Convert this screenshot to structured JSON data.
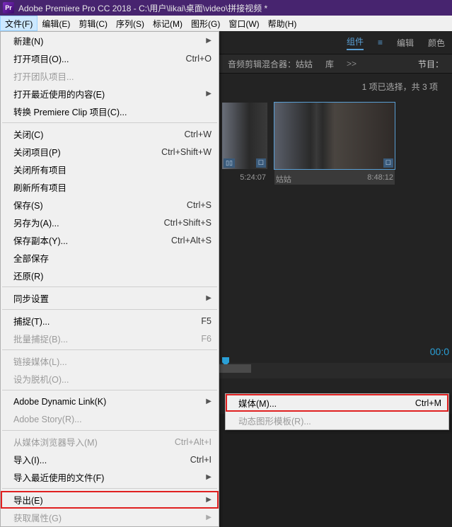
{
  "titlebar": {
    "app_icon_text": "Pr",
    "title": "Adobe Premiere Pro CC 2018 - C:\\用户\\likai\\桌面\\video\\拼接视频 *"
  },
  "menubar": {
    "items": [
      "文件(F)",
      "编辑(E)",
      "剪辑(C)",
      "序列(S)",
      "标记(M)",
      "图形(G)",
      "窗口(W)",
      "帮助(H)"
    ]
  },
  "tabs": {
    "items": [
      "组件",
      "编辑",
      "颜色"
    ],
    "active_index": 0
  },
  "subtabs": {
    "left": "音频剪辑混合器：姑姑",
    "mid": "库",
    "chev": ">>",
    "right": "节目："
  },
  "status": "1 项已选择，共 3 项",
  "thumbs": [
    {
      "name": "",
      "time": "5:24:07",
      "badge_left": "▯▯",
      "badge_right": "☐"
    },
    {
      "name": "姑姑",
      "time": "8:48:12",
      "badge_left": "",
      "badge_right": "☐"
    }
  ],
  "timecode": "00:0",
  "file_menu": [
    {
      "label": "新建(N)",
      "submenu": true
    },
    {
      "label": "打开项目(O)...",
      "shortcut": "Ctrl+O"
    },
    {
      "label": "打开团队项目...",
      "disabled": true
    },
    {
      "label": "打开最近使用的内容(E)",
      "submenu": true
    },
    {
      "label": "转换 Premiere Clip 项目(C)..."
    },
    {
      "sep": true
    },
    {
      "label": "关闭(C)",
      "shortcut": "Ctrl+W"
    },
    {
      "label": "关闭项目(P)",
      "shortcut": "Ctrl+Shift+W"
    },
    {
      "label": "关闭所有项目"
    },
    {
      "label": "刷新所有项目"
    },
    {
      "label": "保存(S)",
      "shortcut": "Ctrl+S"
    },
    {
      "label": "另存为(A)...",
      "shortcut": "Ctrl+Shift+S"
    },
    {
      "label": "保存副本(Y)...",
      "shortcut": "Ctrl+Alt+S"
    },
    {
      "label": "全部保存"
    },
    {
      "label": "还原(R)"
    },
    {
      "sep": true
    },
    {
      "label": "同步设置",
      "submenu": true
    },
    {
      "sep": true
    },
    {
      "label": "捕捉(T)...",
      "shortcut": "F5"
    },
    {
      "label": "批量捕捉(B)...",
      "shortcut": "F6",
      "disabled": true
    },
    {
      "sep": true
    },
    {
      "label": "链接媒体(L)...",
      "disabled": true
    },
    {
      "label": "设为脱机(O)...",
      "disabled": true
    },
    {
      "sep": true
    },
    {
      "label": "Adobe Dynamic Link(K)",
      "submenu": true
    },
    {
      "label": "Adobe Story(R)...",
      "disabled": true
    },
    {
      "sep": true
    },
    {
      "label": "从媒体浏览器导入(M)",
      "shortcut": "Ctrl+Alt+I",
      "disabled": true
    },
    {
      "label": "导入(I)...",
      "shortcut": "Ctrl+I"
    },
    {
      "label": "导入最近使用的文件(F)",
      "submenu": true
    },
    {
      "sep": true
    },
    {
      "label": "导出(E)",
      "submenu": true,
      "highlighted": true
    },
    {
      "label": "获取属性(G)",
      "submenu": true,
      "disabled": true
    }
  ],
  "export_submenu": [
    {
      "label": "媒体(M)...",
      "shortcut": "Ctrl+M",
      "highlighted": true
    },
    {
      "label": "动态图形模板(R)...",
      "disabled": true
    }
  ]
}
